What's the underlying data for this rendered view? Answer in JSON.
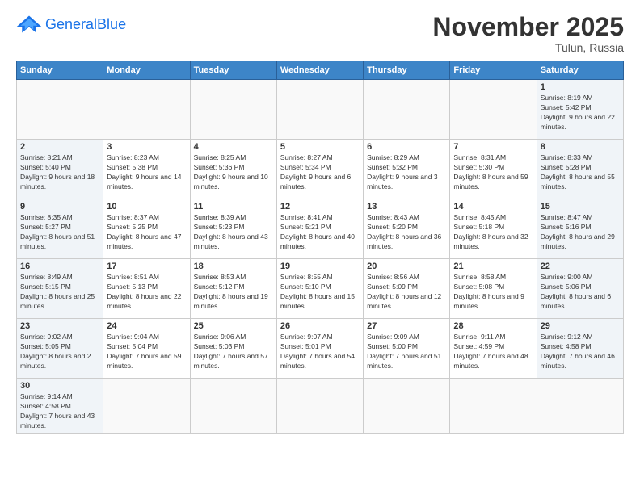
{
  "header": {
    "logo_general": "General",
    "logo_blue": "Blue",
    "month_title": "November 2025",
    "subtitle": "Tulun, Russia"
  },
  "weekdays": [
    "Sunday",
    "Monday",
    "Tuesday",
    "Wednesday",
    "Thursday",
    "Friday",
    "Saturday"
  ],
  "cells": [
    {
      "day": "",
      "empty": true
    },
    {
      "day": "",
      "empty": true
    },
    {
      "day": "",
      "empty": true
    },
    {
      "day": "",
      "empty": true
    },
    {
      "day": "",
      "empty": true
    },
    {
      "day": "",
      "empty": true
    },
    {
      "day": "1",
      "sunrise": "Sunrise: 8:19 AM",
      "sunset": "Sunset: 5:42 PM",
      "daylight": "Daylight: 9 hours and 22 minutes."
    },
    {
      "day": "2",
      "sunrise": "Sunrise: 8:21 AM",
      "sunset": "Sunset: 5:40 PM",
      "daylight": "Daylight: 9 hours and 18 minutes."
    },
    {
      "day": "3",
      "sunrise": "Sunrise: 8:23 AM",
      "sunset": "Sunset: 5:38 PM",
      "daylight": "Daylight: 9 hours and 14 minutes."
    },
    {
      "day": "4",
      "sunrise": "Sunrise: 8:25 AM",
      "sunset": "Sunset: 5:36 PM",
      "daylight": "Daylight: 9 hours and 10 minutes."
    },
    {
      "day": "5",
      "sunrise": "Sunrise: 8:27 AM",
      "sunset": "Sunset: 5:34 PM",
      "daylight": "Daylight: 9 hours and 6 minutes."
    },
    {
      "day": "6",
      "sunrise": "Sunrise: 8:29 AM",
      "sunset": "Sunset: 5:32 PM",
      "daylight": "Daylight: 9 hours and 3 minutes."
    },
    {
      "day": "7",
      "sunrise": "Sunrise: 8:31 AM",
      "sunset": "Sunset: 5:30 PM",
      "daylight": "Daylight: 8 hours and 59 minutes."
    },
    {
      "day": "8",
      "sunrise": "Sunrise: 8:33 AM",
      "sunset": "Sunset: 5:28 PM",
      "daylight": "Daylight: 8 hours and 55 minutes."
    },
    {
      "day": "9",
      "sunrise": "Sunrise: 8:35 AM",
      "sunset": "Sunset: 5:27 PM",
      "daylight": "Daylight: 8 hours and 51 minutes."
    },
    {
      "day": "10",
      "sunrise": "Sunrise: 8:37 AM",
      "sunset": "Sunset: 5:25 PM",
      "daylight": "Daylight: 8 hours and 47 minutes."
    },
    {
      "day": "11",
      "sunrise": "Sunrise: 8:39 AM",
      "sunset": "Sunset: 5:23 PM",
      "daylight": "Daylight: 8 hours and 43 minutes."
    },
    {
      "day": "12",
      "sunrise": "Sunrise: 8:41 AM",
      "sunset": "Sunset: 5:21 PM",
      "daylight": "Daylight: 8 hours and 40 minutes."
    },
    {
      "day": "13",
      "sunrise": "Sunrise: 8:43 AM",
      "sunset": "Sunset: 5:20 PM",
      "daylight": "Daylight: 8 hours and 36 minutes."
    },
    {
      "day": "14",
      "sunrise": "Sunrise: 8:45 AM",
      "sunset": "Sunset: 5:18 PM",
      "daylight": "Daylight: 8 hours and 32 minutes."
    },
    {
      "day": "15",
      "sunrise": "Sunrise: 8:47 AM",
      "sunset": "Sunset: 5:16 PM",
      "daylight": "Daylight: 8 hours and 29 minutes."
    },
    {
      "day": "16",
      "sunrise": "Sunrise: 8:49 AM",
      "sunset": "Sunset: 5:15 PM",
      "daylight": "Daylight: 8 hours and 25 minutes."
    },
    {
      "day": "17",
      "sunrise": "Sunrise: 8:51 AM",
      "sunset": "Sunset: 5:13 PM",
      "daylight": "Daylight: 8 hours and 22 minutes."
    },
    {
      "day": "18",
      "sunrise": "Sunrise: 8:53 AM",
      "sunset": "Sunset: 5:12 PM",
      "daylight": "Daylight: 8 hours and 19 minutes."
    },
    {
      "day": "19",
      "sunrise": "Sunrise: 8:55 AM",
      "sunset": "Sunset: 5:10 PM",
      "daylight": "Daylight: 8 hours and 15 minutes."
    },
    {
      "day": "20",
      "sunrise": "Sunrise: 8:56 AM",
      "sunset": "Sunset: 5:09 PM",
      "daylight": "Daylight: 8 hours and 12 minutes."
    },
    {
      "day": "21",
      "sunrise": "Sunrise: 8:58 AM",
      "sunset": "Sunset: 5:08 PM",
      "daylight": "Daylight: 8 hours and 9 minutes."
    },
    {
      "day": "22",
      "sunrise": "Sunrise: 9:00 AM",
      "sunset": "Sunset: 5:06 PM",
      "daylight": "Daylight: 8 hours and 6 minutes."
    },
    {
      "day": "23",
      "sunrise": "Sunrise: 9:02 AM",
      "sunset": "Sunset: 5:05 PM",
      "daylight": "Daylight: 8 hours and 2 minutes."
    },
    {
      "day": "24",
      "sunrise": "Sunrise: 9:04 AM",
      "sunset": "Sunset: 5:04 PM",
      "daylight": "Daylight: 7 hours and 59 minutes."
    },
    {
      "day": "25",
      "sunrise": "Sunrise: 9:06 AM",
      "sunset": "Sunset: 5:03 PM",
      "daylight": "Daylight: 7 hours and 57 minutes."
    },
    {
      "day": "26",
      "sunrise": "Sunrise: 9:07 AM",
      "sunset": "Sunset: 5:01 PM",
      "daylight": "Daylight: 7 hours and 54 minutes."
    },
    {
      "day": "27",
      "sunrise": "Sunrise: 9:09 AM",
      "sunset": "Sunset: 5:00 PM",
      "daylight": "Daylight: 7 hours and 51 minutes."
    },
    {
      "day": "28",
      "sunrise": "Sunrise: 9:11 AM",
      "sunset": "Sunset: 4:59 PM",
      "daylight": "Daylight: 7 hours and 48 minutes."
    },
    {
      "day": "29",
      "sunrise": "Sunrise: 9:12 AM",
      "sunset": "Sunset: 4:58 PM",
      "daylight": "Daylight: 7 hours and 46 minutes."
    },
    {
      "day": "30",
      "sunrise": "Sunrise: 9:14 AM",
      "sunset": "Sunset: 4:58 PM",
      "daylight": "Daylight: 7 hours and 43 minutes."
    },
    {
      "day": "",
      "empty": true
    },
    {
      "day": "",
      "empty": true
    },
    {
      "day": "",
      "empty": true
    },
    {
      "day": "",
      "empty": true
    },
    {
      "day": "",
      "empty": true
    },
    {
      "day": "",
      "empty": true
    }
  ]
}
